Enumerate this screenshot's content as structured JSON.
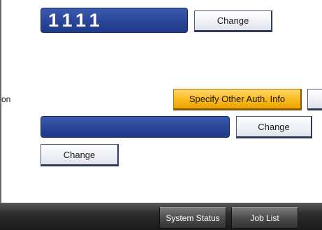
{
  "login": {
    "value": "1111",
    "change_label": "Change"
  },
  "auth": {
    "side_label": "on",
    "specify_label": "Specify Other Auth. Info",
    "partial_button_label": ""
  },
  "password": {
    "value": "",
    "change_label": "Change"
  },
  "third": {
    "change_label": "Change"
  },
  "footer": {
    "system_status_label": "System Status",
    "job_list_label": "Job List"
  },
  "colors": {
    "field_blue": "#2a4596",
    "highlight_orange": "#f9b91d",
    "footer_dark": "#2d2d2d"
  }
}
